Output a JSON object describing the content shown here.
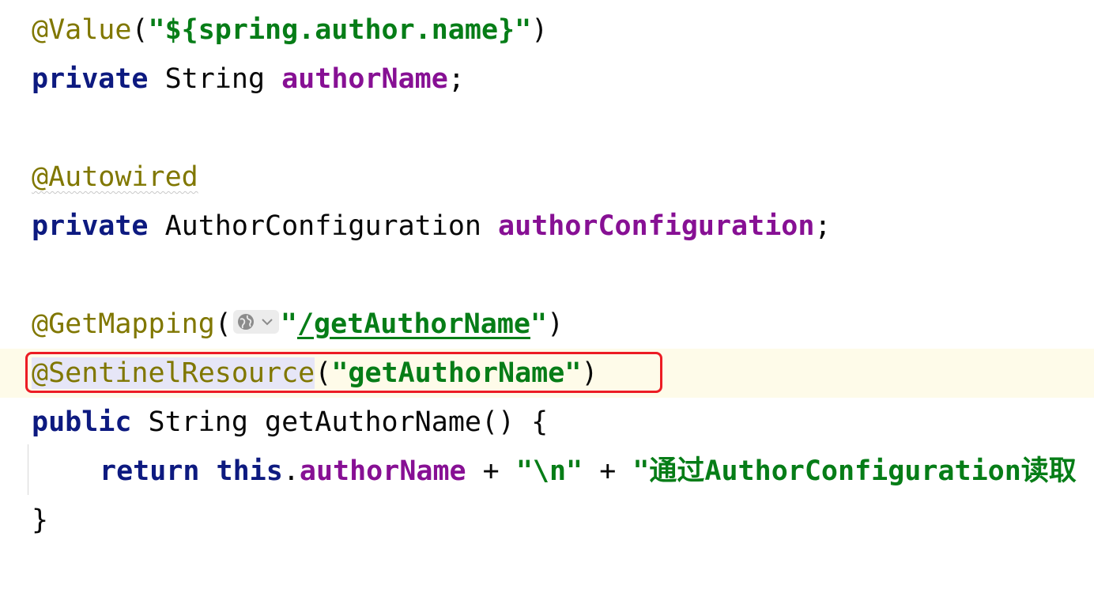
{
  "colors": {
    "keyword": "#0d1a80",
    "annotation": "#807700",
    "string": "#067d17",
    "field": "#871094",
    "caret_line_bg": "#fefbe9",
    "highlight_border": "#ec1c24"
  },
  "lines": {
    "l1": {
      "annotation": "@Value",
      "open": "(",
      "string": "\"${spring.author.name}\"",
      "close": ")"
    },
    "l2": {
      "modifier": "private",
      "type": "String",
      "field": "authorName",
      "semi": ";"
    },
    "l4": {
      "annotation": "@Autowired"
    },
    "l5": {
      "modifier": "private",
      "type": "AuthorConfiguration",
      "field": "authorConfiguration",
      "semi": ";"
    },
    "l7": {
      "annotation": "@GetMapping",
      "open": "(",
      "inlay_icon": "globe-icon",
      "quote_open": "\"",
      "path": "/getAuthorName",
      "quote_close": "\"",
      "close": ")"
    },
    "l8": {
      "annotation": "@SentinelResource",
      "open": "(",
      "string": "\"getAuthorName\"",
      "close": ")"
    },
    "l9": {
      "modifier": "public",
      "type": "String",
      "method": "getAuthorName() {"
    },
    "l10": {
      "keyword_return": "return",
      "keyword_this": "this",
      "dot": ".",
      "field": "authorName",
      "op1": " + ",
      "str1": "\"\\n\"",
      "op2": " + ",
      "str2": "\"通过AuthorConfiguration读取"
    },
    "l11": {
      "brace": "}"
    }
  }
}
